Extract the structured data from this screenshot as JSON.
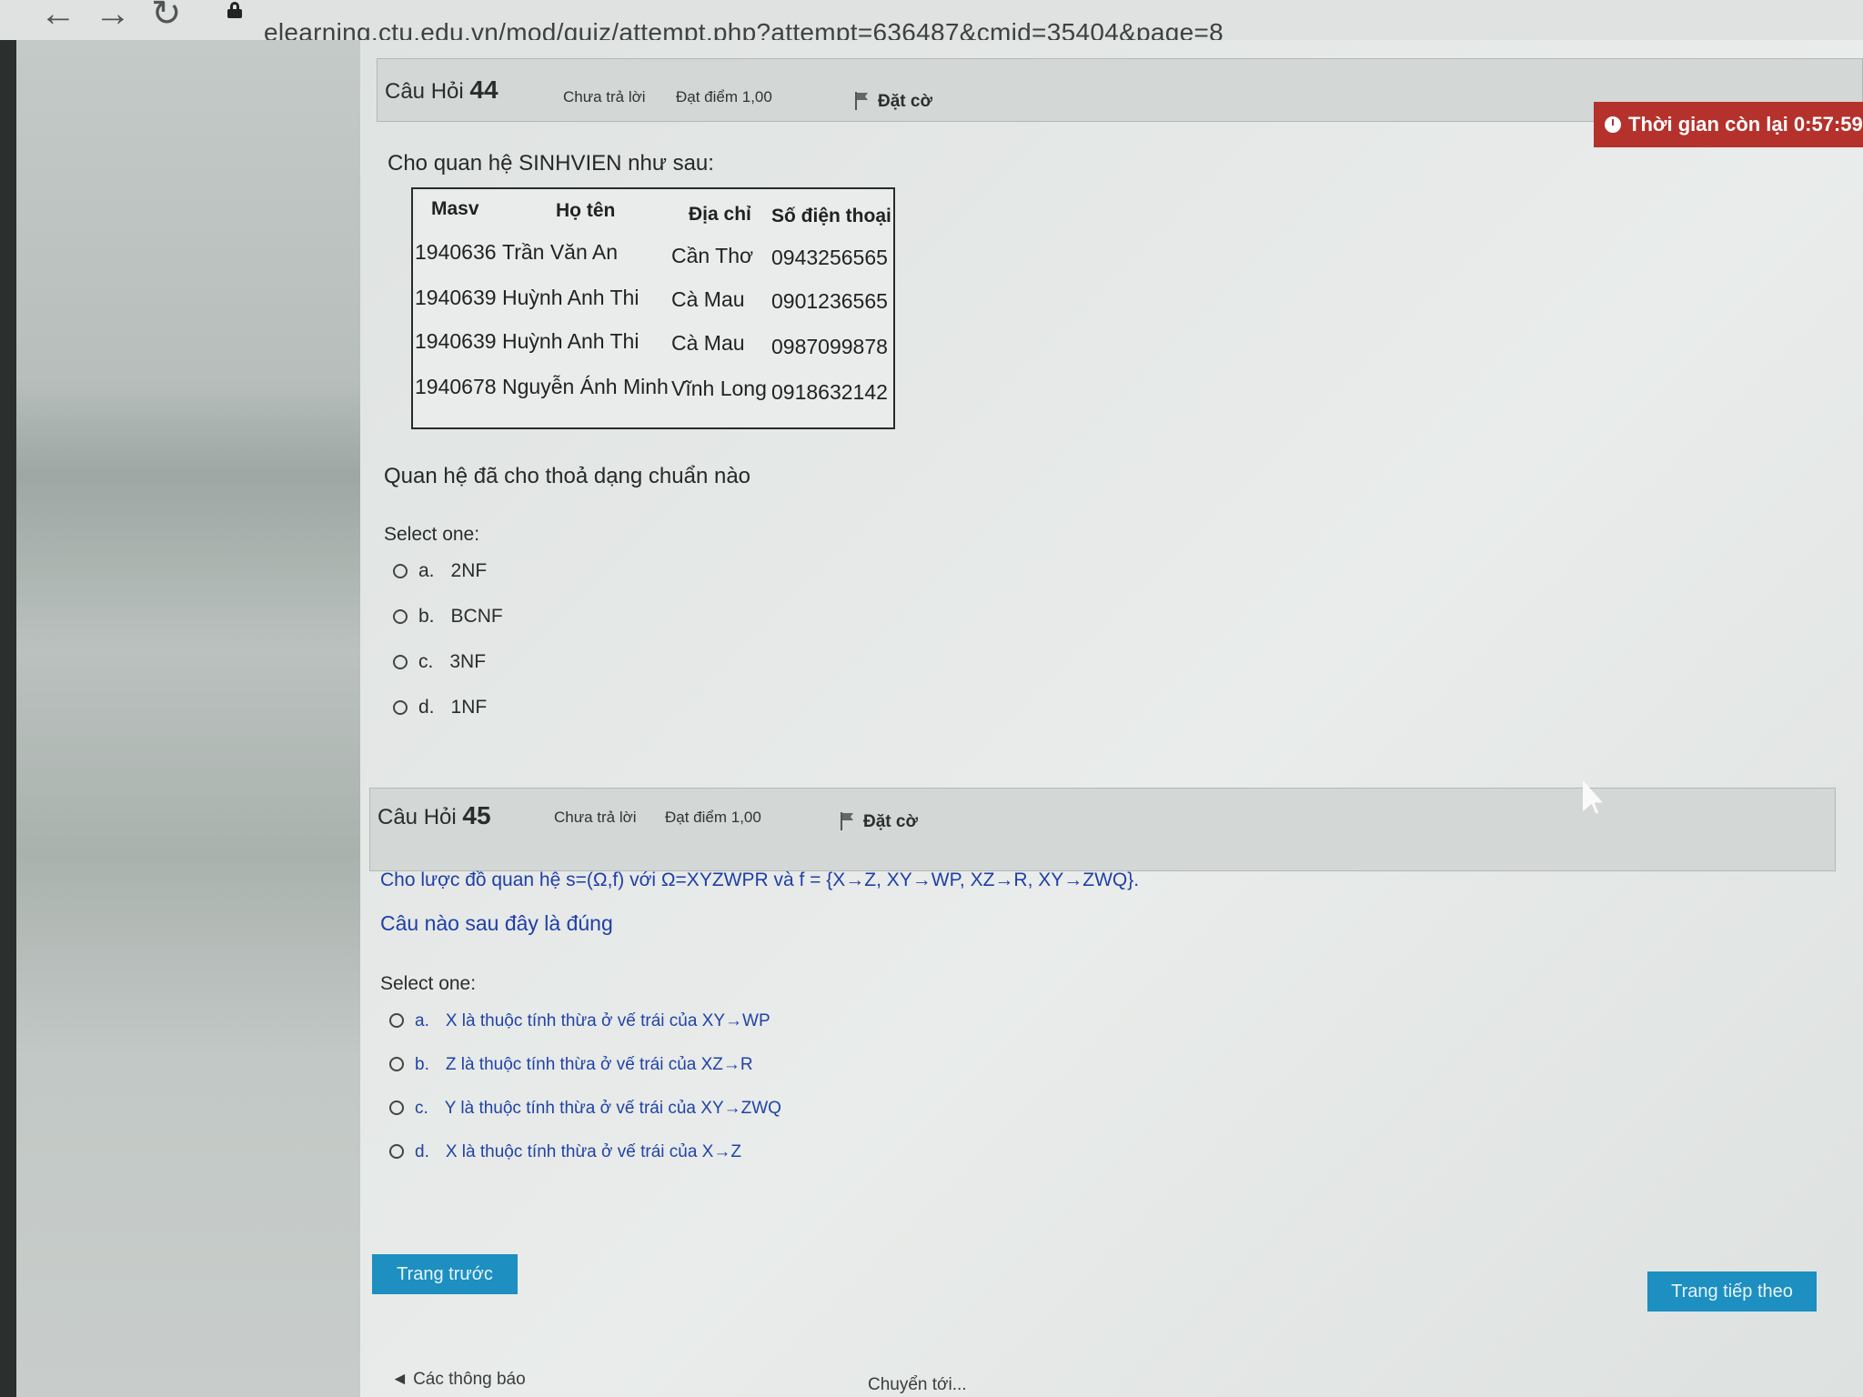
{
  "browser": {
    "url": "elearning.ctu.edu.vn/mod/quiz/attempt.php?attempt=636487&cmid=35404&page=8"
  },
  "timer": {
    "label": "Thời gian còn lại 0:57:59"
  },
  "q44": {
    "title": "Câu Hỏi",
    "number": "44",
    "state": "Chưa trả lời",
    "grade": "Đạt điểm 1,00",
    "flag": "Đặt cờ",
    "intro": "Cho quan hệ SINHVIEN như sau:",
    "table": {
      "headers": [
        "Masv",
        "Họ tên",
        "Địa chỉ",
        "Số điện thoại"
      ],
      "rows": [
        [
          "1940636",
          "Trần Văn An",
          "Cần Thơ",
          "0943256565"
        ],
        [
          "1940639",
          "Huỳnh Anh Thi",
          "Cà Mau",
          "0901236565"
        ],
        [
          "1940639",
          "Huỳnh Anh Thi",
          "Cà Mau",
          "0987099878"
        ],
        [
          "1940678",
          "Nguyễn Ánh Minh",
          "Vĩnh Long",
          "0918632142"
        ]
      ]
    },
    "question": "Quan hệ đã cho thoả dạng chuẩn nào",
    "select_one": "Select one:",
    "options": [
      {
        "letter": "a.",
        "text": "2NF"
      },
      {
        "letter": "b.",
        "text": "BCNF"
      },
      {
        "letter": "c.",
        "text": "3NF"
      },
      {
        "letter": "d.",
        "text": "1NF"
      }
    ]
  },
  "q45": {
    "title": "Câu Hỏi",
    "number": "45",
    "state": "Chưa trả lời",
    "grade": "Đạt điểm 1,00",
    "flag": "Đặt cờ",
    "line1": "Cho lược đồ quan hệ s=(Ω,f) với Ω=XYZWPR và f = {X→Z, XY→WP, XZ→R, XY→ZWQ}.",
    "line2": "Câu nào sau đây là đúng",
    "select_one": "Select one:",
    "options": [
      {
        "letter": "a.",
        "text": "X là thuộc tính thừa ở vế trái của XY→WP"
      },
      {
        "letter": "b.",
        "text": "Z là thuộc tính thừa ở vế trái của XZ→R"
      },
      {
        "letter": "c.",
        "text": "Y là thuộc tính thừa ở vế trái của XY→ZWQ"
      },
      {
        "letter": "d.",
        "text": "X là thuộc tính thừa ở vế trái của X→Z"
      }
    ]
  },
  "nav": {
    "prev": "Trang trước",
    "next": "Trang tiếp theo"
  },
  "footer": {
    "announcements": "◄ Các thông báo",
    "jump_to": "Chuyển tới..."
  }
}
